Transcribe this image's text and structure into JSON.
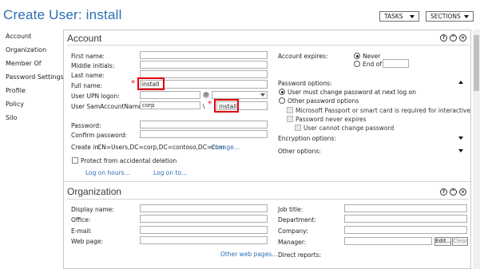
{
  "header": {
    "title": "Create User: install",
    "tasks_label": "TASKS",
    "sections_label": "SECTIONS"
  },
  "nav": [
    "Account",
    "Organization",
    "Member Of",
    "Password Settings",
    "Profile",
    "Policy",
    "Silo"
  ],
  "account": {
    "heading": "Account",
    "first_name_label": "First name:",
    "middle_initials_label": "Middle initials:",
    "last_name_label": "Last name:",
    "full_name_label": "Full name:",
    "full_name_value": "install",
    "upn_label": "User UPN logon:",
    "upn_at": "@",
    "sam_label": "User SamAccountName l...",
    "sam_domain_value": "corp",
    "sam_backslash": "\\",
    "sam_value": "install",
    "password_label": "Password:",
    "confirm_password_label": "Confirm password:",
    "create_in_label": "Create in:",
    "create_in_value": "CN=Users,DC=corp,DC=contoso,DC=com",
    "change_link": "Change...",
    "protect_label": "Protect from accidental deletion",
    "log_on_hours_link": "Log on hours...",
    "log_on_to_link": "Log on to...",
    "expires_label": "Account expires:",
    "never_label": "Never",
    "end_of_label": "End of",
    "password_options_label": "Password options:",
    "must_change_label": "User must change password at next log on",
    "other_options_label": "Other password options",
    "passport_label": "Microsoft Passport or smart card is required for interactive log...",
    "never_expires_label": "Password never expires",
    "cannot_change_label": "User cannot change password",
    "encryption_label": "Encryption options:",
    "other_label": "Other options:"
  },
  "organization": {
    "heading": "Organization",
    "display_name_label": "Display name:",
    "office_label": "Office:",
    "email_label": "E-mail:",
    "web_page_label": "Web page:",
    "other_web_link": "Other web pages...",
    "job_title_label": "Job title:",
    "department_label": "Department:",
    "company_label": "Company:",
    "manager_label": "Manager:",
    "edit_label": "Edit...",
    "clear_label": "Clear",
    "direct_reports_label": "Direct reports:"
  },
  "controls": {
    "help": "?",
    "collapse": "^",
    "close": "×"
  },
  "colors": {
    "accent": "#2a6fb5",
    "highlight": "#e0000c",
    "required": "#e0555a"
  }
}
